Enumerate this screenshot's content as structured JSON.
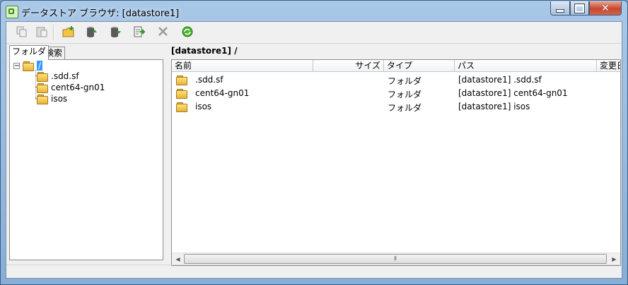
{
  "window": {
    "title": "データストア ブラウザ: [datastore1]",
    "min_label": "minimize",
    "max_label": "maximize",
    "close_label": "close"
  },
  "toolbar": {
    "buttons": [
      {
        "name": "copy-button",
        "icon": "copy-icon",
        "enabled": false
      },
      {
        "name": "paste-button",
        "icon": "paste-icon",
        "enabled": false
      },
      {
        "name": "new-folder-button",
        "icon": "new-folder-icon",
        "enabled": true
      },
      {
        "name": "upload-button",
        "icon": "upload-icon",
        "enabled": true
      },
      {
        "name": "download-button",
        "icon": "download-icon",
        "enabled": true
      },
      {
        "name": "register-vm-button",
        "icon": "register-icon",
        "enabled": true
      },
      {
        "name": "delete-button",
        "icon": "delete-icon",
        "enabled": false
      },
      {
        "name": "refresh-button",
        "icon": "refresh-icon",
        "enabled": true
      }
    ]
  },
  "left": {
    "tabs": [
      {
        "label": "フォルダ",
        "active": true
      },
      {
        "label": "検索",
        "active": false
      }
    ],
    "tree": {
      "root": {
        "label": "/",
        "expander": "−"
      },
      "children": [
        ".sdd.sf",
        "cent64-gn01",
        "isos"
      ]
    }
  },
  "right": {
    "path": "[datastore1] /",
    "columns": [
      "名前",
      "サイズ",
      "タイプ",
      "パス",
      "変更日時"
    ],
    "rows": [
      {
        "name": ".sdd.sf",
        "size": "",
        "type": "フォルダ",
        "path": "[datastore1] .sdd.sf"
      },
      {
        "name": "cent64-gn01",
        "size": "",
        "type": "フォルダ",
        "path": "[datastore1] cent64-gn01"
      },
      {
        "name": "isos",
        "size": "",
        "type": "フォルダ",
        "path": "[datastore1] isos"
      }
    ],
    "scroll": {
      "left": "◀",
      "right": "▶",
      "grip": "⦀"
    }
  }
}
